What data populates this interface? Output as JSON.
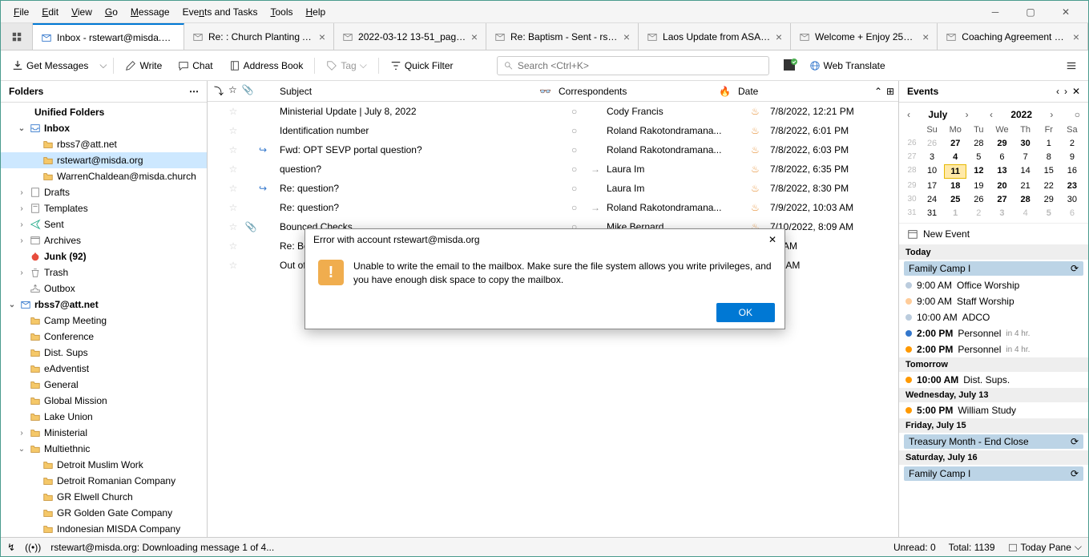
{
  "menu": [
    "File",
    "Edit",
    "View",
    "Go",
    "Message",
    "Events and Tasks",
    "Tools",
    "Help"
  ],
  "tabs": [
    {
      "label": "Inbox - rstewart@misda.or…",
      "active": true,
      "closable": false
    },
    {
      "label": "Re: : Church Planting A…",
      "active": false,
      "closable": true
    },
    {
      "label": "2022-03-12 13-51_page…",
      "active": false,
      "closable": true
    },
    {
      "label": "Re: Baptism - Sent - rste…",
      "active": false,
      "closable": true
    },
    {
      "label": "Laos Update from ASAP…",
      "active": false,
      "closable": true
    },
    {
      "label": "Welcome + Enjoy 25%…",
      "active": false,
      "closable": true
    },
    {
      "label": "Coaching Agreement M…",
      "active": false,
      "closable": true
    }
  ],
  "toolbar": {
    "get_messages": "Get Messages",
    "write": "Write",
    "chat": "Chat",
    "address": "Address Book",
    "tag": "Tag",
    "quick_filter": "Quick Filter",
    "search_placeholder": "Search <Ctrl+K>",
    "web_translate": "Web Translate"
  },
  "folders_header": "Folders",
  "folder_tree": [
    {
      "label": "Unified Folders",
      "type": "section",
      "depth": 0,
      "bold": true
    },
    {
      "label": "Inbox",
      "type": "inbox",
      "depth": 1,
      "bold": true,
      "expanded": true
    },
    {
      "label": "rbss7@att.net",
      "type": "sub",
      "depth": 2
    },
    {
      "label": "rstewart@misda.org",
      "type": "sub",
      "depth": 2,
      "selected": true
    },
    {
      "label": "WarrenChaldean@misda.church",
      "type": "sub",
      "depth": 2
    },
    {
      "label": "Drafts",
      "type": "drafts",
      "depth": 1,
      "twisty": true
    },
    {
      "label": "Templates",
      "type": "templates",
      "depth": 1,
      "twisty": true
    },
    {
      "label": "Sent",
      "type": "sent",
      "depth": 1,
      "twisty": true
    },
    {
      "label": "Archives",
      "type": "archives",
      "depth": 1,
      "twisty": true
    },
    {
      "label": "Junk (92)",
      "type": "junk",
      "depth": 1,
      "bold": true
    },
    {
      "label": "Trash",
      "type": "trash",
      "depth": 1,
      "twisty": true
    },
    {
      "label": "Outbox",
      "type": "outbox",
      "depth": 1
    },
    {
      "label": "rbss7@att.net",
      "type": "account",
      "depth": 0,
      "bold": true,
      "expanded": true
    },
    {
      "label": "Camp Meeting",
      "type": "folder",
      "depth": 1
    },
    {
      "label": "Conference",
      "type": "folder",
      "depth": 1
    },
    {
      "label": "Dist. Sups",
      "type": "folder",
      "depth": 1
    },
    {
      "label": "eAdventist",
      "type": "folder",
      "depth": 1
    },
    {
      "label": "General",
      "type": "folder",
      "depth": 1
    },
    {
      "label": "Global Mission",
      "type": "folder",
      "depth": 1
    },
    {
      "label": "Lake Union",
      "type": "folder",
      "depth": 1
    },
    {
      "label": "Ministerial",
      "type": "folder",
      "depth": 1,
      "twisty": true
    },
    {
      "label": "Multiethnic",
      "type": "folder",
      "depth": 1,
      "expanded": true
    },
    {
      "label": "Detroit Muslim Work",
      "type": "folder",
      "depth": 2
    },
    {
      "label": "Detroit Romanian Company",
      "type": "folder",
      "depth": 2
    },
    {
      "label": "GR Elwell Church",
      "type": "folder",
      "depth": 2
    },
    {
      "label": "GR Golden Gate Company",
      "type": "folder",
      "depth": 2
    },
    {
      "label": "Indonesian MISDA Company",
      "type": "folder",
      "depth": 2
    }
  ],
  "columns": {
    "subject": "Subject",
    "correspondents": "Correspondents",
    "date": "Date"
  },
  "messages": [
    {
      "subject": "Ministerial Update | July 8, 2022",
      "from": "Cody Francis",
      "date": "7/8/2022, 12:21 PM",
      "attach": false,
      "reply": false
    },
    {
      "subject": "Identification number",
      "from": "Roland Rakotondramana...",
      "date": "7/8/2022, 6:01 PM",
      "attach": false,
      "reply": false
    },
    {
      "subject": "Fwd: OPT SEVP portal question?",
      "from": "Roland Rakotondramana...",
      "date": "7/8/2022, 6:03 PM",
      "attach": false,
      "reply": true
    },
    {
      "subject": "question?",
      "from": "Laura Im",
      "date": "7/8/2022, 6:35 PM",
      "attach": false,
      "reply": false,
      "out": true
    },
    {
      "subject": "Re: question?",
      "from": "Laura Im",
      "date": "7/8/2022, 8:30 PM",
      "attach": false,
      "reply": true
    },
    {
      "subject": "Re: question?",
      "from": "Roland Rakotondramana...",
      "date": "7/9/2022, 10:03 AM",
      "attach": false,
      "reply": false,
      "out": true
    },
    {
      "subject": "Bounced Checks",
      "from": "Mike Bernard",
      "date": "7/10/2022, 8:09 AM",
      "attach": true,
      "reply": false
    },
    {
      "subject": "Re: Bo",
      "from": "",
      "date": "34 AM",
      "attach": false,
      "reply": false,
      "partial": true
    },
    {
      "subject": "Out of",
      "from": "",
      "date": ":25 AM",
      "attach": false,
      "reply": false,
      "partial": true
    }
  ],
  "dialog": {
    "title": "Error with account rstewart@misda.org",
    "body": "Unable to write the email to the mailbox. Make sure the file system allows you write privileges, and you have enough disk space to copy the mailbox.",
    "ok": "OK"
  },
  "events": {
    "header": "Events",
    "month": "July",
    "year": "2022",
    "dow": [
      "Su",
      "Mo",
      "Tu",
      "We",
      "Th",
      "Fr",
      "Sa"
    ],
    "weeks": [
      [
        {
          "d": "26",
          "o": true
        },
        {
          "d": "27",
          "b": true
        },
        {
          "d": "28"
        },
        {
          "d": "29",
          "b": true
        },
        {
          "d": "30",
          "b": true
        },
        {
          "d": "1"
        },
        {
          "d": "2"
        }
      ],
      [
        {
          "d": "3"
        },
        {
          "d": "4",
          "b": true
        },
        {
          "d": "5"
        },
        {
          "d": "6"
        },
        {
          "d": "7"
        },
        {
          "d": "8"
        },
        {
          "d": "9"
        }
      ],
      [
        {
          "d": "10"
        },
        {
          "d": "11",
          "today": true
        },
        {
          "d": "12",
          "b": true
        },
        {
          "d": "13",
          "b": true
        },
        {
          "d": "14"
        },
        {
          "d": "15"
        },
        {
          "d": "16"
        }
      ],
      [
        {
          "d": "17"
        },
        {
          "d": "18",
          "b": true
        },
        {
          "d": "19"
        },
        {
          "d": "20",
          "b": true
        },
        {
          "d": "21"
        },
        {
          "d": "22"
        },
        {
          "d": "23",
          "b": true
        }
      ],
      [
        {
          "d": "24"
        },
        {
          "d": "25",
          "b": true
        },
        {
          "d": "26"
        },
        {
          "d": "27",
          "b": true
        },
        {
          "d": "28",
          "b": true
        },
        {
          "d": "29"
        },
        {
          "d": "30"
        }
      ],
      [
        {
          "d": "31"
        },
        {
          "d": "1",
          "b": true,
          "o": true
        },
        {
          "d": "2",
          "o": true
        },
        {
          "d": "3",
          "b": true,
          "o": true
        },
        {
          "d": "4",
          "o": true
        },
        {
          "d": "5",
          "b": true,
          "o": true
        },
        {
          "d": "6",
          "o": true
        }
      ]
    ],
    "weeknums": [
      "26",
      "27",
      "28",
      "29",
      "30",
      "31"
    ],
    "new_event": "New Event",
    "agenda": [
      {
        "type": "day",
        "label": "Today"
      },
      {
        "type": "allday",
        "label": "Family Camp I"
      },
      {
        "type": "item",
        "time": "9:00 AM",
        "label": "Office Worship",
        "color": "#bcd"
      },
      {
        "type": "item",
        "time": "9:00 AM",
        "label": "Staff Worship",
        "color": "#fc9"
      },
      {
        "type": "item",
        "time": "10:00 AM",
        "label": "ADCO",
        "color": "#bcd"
      },
      {
        "type": "item",
        "time": "2:00 PM",
        "label": "Personnel",
        "suffix": "in 4 hr.",
        "color": "#37c",
        "bold": true
      },
      {
        "type": "item",
        "time": "2:00 PM",
        "label": "Personnel",
        "suffix": "in 4 hr.",
        "color": "#f90",
        "bold": true
      },
      {
        "type": "day",
        "label": "Tomorrow"
      },
      {
        "type": "item",
        "time": "10:00 AM",
        "label": "Dist. Sups.",
        "color": "#f90",
        "bold": true
      },
      {
        "type": "day",
        "label": "Wednesday, July 13"
      },
      {
        "type": "item",
        "time": "5:00 PM",
        "label": "William Study",
        "color": "#f90",
        "bold": true
      },
      {
        "type": "day",
        "label": "Friday, July 15"
      },
      {
        "type": "allday",
        "label": "Treasury Month - End Close"
      },
      {
        "type": "day",
        "label": "Saturday, July 16"
      },
      {
        "type": "allday",
        "label": "Family Camp I"
      }
    ]
  },
  "status": {
    "activity": "rstewart@misda.org: Downloading message 1 of 4...",
    "unread": "Unread: 0",
    "total": "Total: 1139",
    "today_pane": "Today Pane"
  }
}
